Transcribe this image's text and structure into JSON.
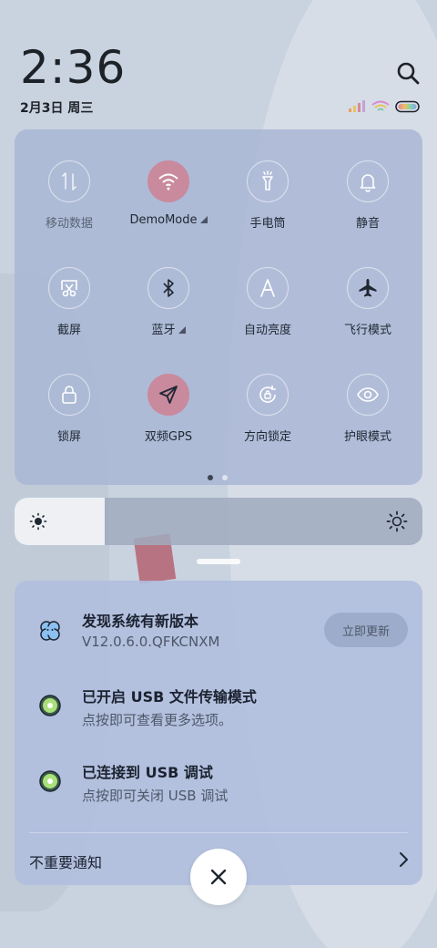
{
  "status": {
    "time": "2:36",
    "date": "2月3日 周三"
  },
  "quick_settings": {
    "tiles": [
      {
        "label": "移动数据",
        "icon": "mobile-data-icon",
        "active": false
      },
      {
        "label": "DemoMode",
        "icon": "wifi-icon",
        "active": true,
        "expandable": true
      },
      {
        "label": "手电筒",
        "icon": "flashlight-icon",
        "active": false
      },
      {
        "label": "静音",
        "icon": "bell-icon",
        "active": false
      },
      {
        "label": "截屏",
        "icon": "screenshot-icon",
        "active": false
      },
      {
        "label": "蓝牙",
        "icon": "bluetooth-icon",
        "active": false,
        "expandable": true
      },
      {
        "label": "自动亮度",
        "icon": "auto-brightness-icon",
        "active": false
      },
      {
        "label": "飞行模式",
        "icon": "airplane-icon",
        "active": false
      },
      {
        "label": "锁屏",
        "icon": "lock-icon",
        "active": false
      },
      {
        "label": "双频GPS",
        "icon": "gps-icon",
        "active": true
      },
      {
        "label": "方向锁定",
        "icon": "rotation-lock-icon",
        "active": false
      },
      {
        "label": "护眼模式",
        "icon": "eye-icon",
        "active": false
      }
    ],
    "page_count": 2,
    "current_page": 1
  },
  "brightness": {
    "level": 0.22
  },
  "notifications": [
    {
      "title": "发现系统有新版本",
      "subtitle": "V12.0.6.0.QFKCNXM",
      "icon": "system-update-icon",
      "action": "立即更新"
    },
    {
      "title": "已开启 USB 文件传输模式",
      "subtitle": "点按即可查看更多选项。",
      "icon": "android-system-icon"
    },
    {
      "title": "已连接到 USB 调试",
      "subtitle": "点按即可关闭 USB 调试",
      "icon": "android-system-icon"
    }
  ],
  "footer": {
    "unimportant_label": "不重要通知"
  },
  "colors": {
    "active_tile": "#c98a9e",
    "panel": "#a8b6d4"
  }
}
